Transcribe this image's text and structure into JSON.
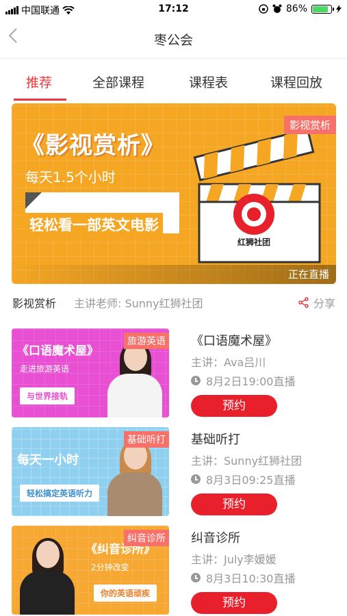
{
  "status_bar": {
    "carrier": "中国联通",
    "time": "17:12",
    "battery_percent": "86%",
    "battery_level": 0.86
  },
  "nav": {
    "back_icon": "chevron-left-icon",
    "title": "枣公会"
  },
  "tabs": [
    {
      "label": "推荐",
      "active": true
    },
    {
      "label": "全部课程",
      "active": false
    },
    {
      "label": "课程表",
      "active": false
    },
    {
      "label": "课程回放",
      "active": false
    }
  ],
  "banner": {
    "title": "《影视赏析》",
    "subtitle": "每天1.5个小时",
    "highlight": "轻松看一部英文电影",
    "tag": "影视赏析",
    "logo_name": "红狮社团",
    "status": "正在直播",
    "colors": {
      "background": "#f5a623",
      "tag": "#f7706a"
    }
  },
  "featured_info": {
    "course": "影视赏析",
    "teacher": "主讲老师: Sunny红狮社团",
    "share_label": "分享"
  },
  "courses": [
    {
      "tag": "旅游英语",
      "thumb_title": "《口语魔术屋》",
      "thumb_sub": "走进旅游英语",
      "thumb_button": "与世界接轨",
      "name": "《口语魔术屋》",
      "lecturer": "主讲：Ava吕川",
      "time": "8月2日19:00直播",
      "button": "预约",
      "thumb_color": "#e84fd2"
    },
    {
      "tag": "基础听打",
      "thumb_title": "每天一小时",
      "thumb_sub": "",
      "thumb_button": "轻松搞定英语听力",
      "name": "基础听打",
      "lecturer": "主讲：Sunny红狮社团",
      "time": "8月3日09:25直播",
      "button": "预约",
      "thumb_color": "#8fd0f0"
    },
    {
      "tag": "纠音诊所",
      "thumb_title": "《纠音诊所》",
      "thumb_sub": "2分钟改变",
      "thumb_button": "你的英语顽疾",
      "name": "纠音诊所",
      "lecturer": "主讲：July李媛媛",
      "time": "8月3日10:30直播",
      "button": "预约",
      "thumb_color": "#f7a833"
    }
  ],
  "accent_color": "#e8373f"
}
